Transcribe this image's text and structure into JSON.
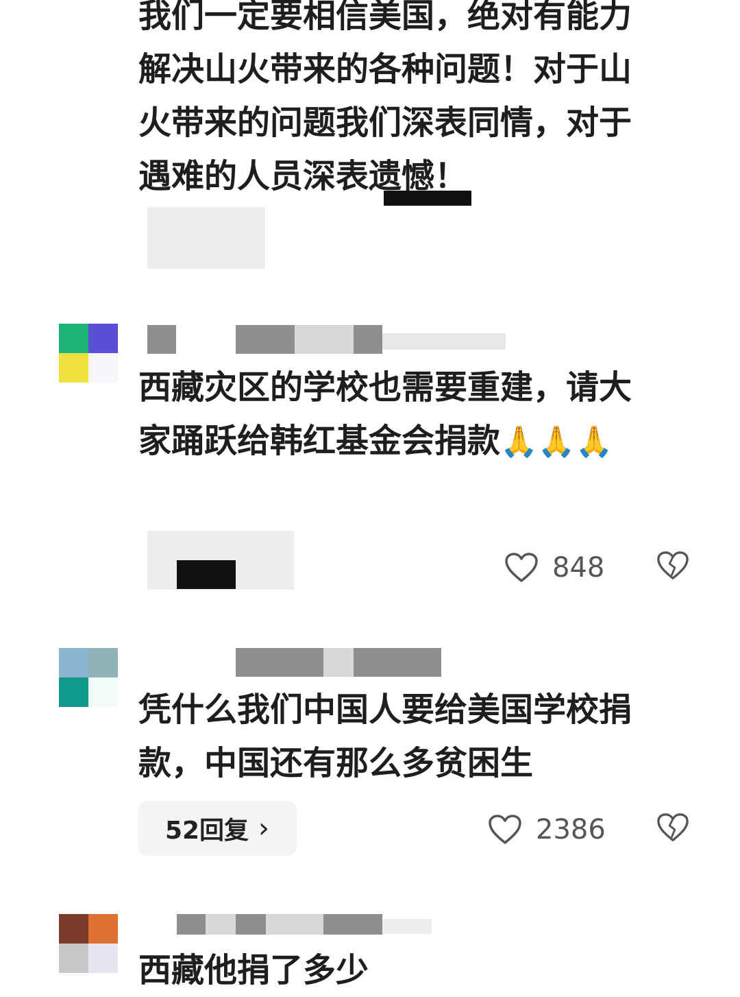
{
  "comments": [
    {
      "text_lines": [
        "我们一定要相信美国，绝对有能力",
        "解决山火带来的各种问题！对于山",
        "火带来的问题我们深表同情，对于",
        "遇难的人员深表遗憾！"
      ]
    },
    {
      "text_lines": [
        "西藏灾区的学校也需要重建，请大",
        "家踊跃给韩红基金会捐款"
      ],
      "emoji": "🙏🙏🙏",
      "likes": "848"
    },
    {
      "text_lines": [
        "凭什么我们中国人要给美国学校捐",
        "款，中国还有那么多贫困生"
      ],
      "reply_label": "52回复",
      "reply_chevron": "›",
      "likes": "2386"
    },
    {
      "text_lines": [
        "西藏他捐了多少"
      ]
    }
  ],
  "icons": {
    "like": "heart-outline-icon",
    "dislike": "broken-heart-icon",
    "chevron": "chevron-right-icon"
  },
  "colors": {
    "text": "#1e1e1e",
    "muted": "#555555",
    "pill": "#f4f4f4"
  }
}
